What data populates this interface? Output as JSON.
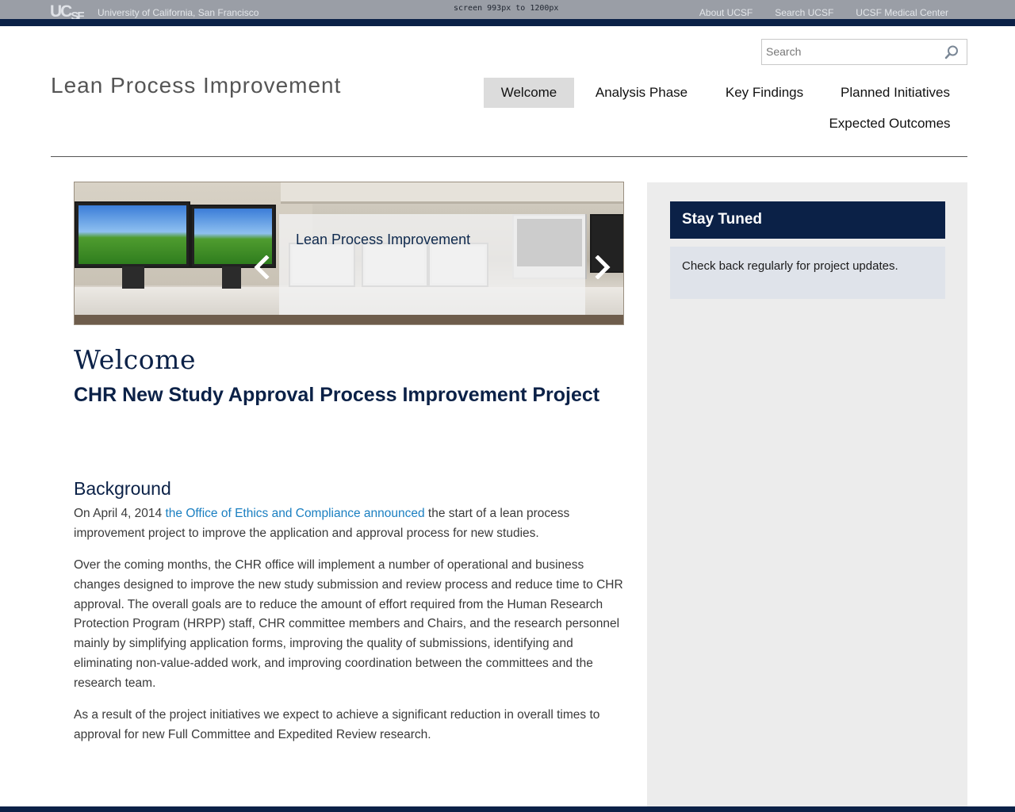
{
  "top_bar": {
    "logo_main": "UC",
    "logo_sub": "SF",
    "university_name": "University of California, San Francisco",
    "screen_note": "screen 993px to 1200px",
    "links": [
      "About UCSF",
      "Search UCSF",
      "UCSF Medical Center"
    ]
  },
  "search": {
    "placeholder": "Search",
    "icon": "search-icon"
  },
  "site_title": "Lean Process Improvement",
  "nav": {
    "items": [
      "Welcome",
      "Analysis Phase",
      "Key Findings",
      "Planned Initiatives",
      "Expected Outcomes"
    ],
    "active": "Welcome"
  },
  "carousel": {
    "caption": "Lean Process Improvement",
    "prev_icon": "chevron-left-icon",
    "next_icon": "chevron-right-icon"
  },
  "main": {
    "welcome_heading": "Welcome",
    "project_title": "CHR New Study Approval Process Improvement Project",
    "background_heading": "Background",
    "para1_start": "On April 4, 2014 ",
    "para1_link": "the Office of Ethics and Compliance announced",
    "para1_end": " the start of a lean process improvement project to improve the application and approval process for new studies.",
    "para2": "Over the coming months, the CHR office will implement a number of operational and business changes designed to improve the new study submission and review process and reduce time to CHR approval. The overall goals are to reduce the amount of effort required from the Human Research Protection Program (HRPP) staff, CHR committee members and Chairs, and the research personnel mainly by simplifying application forms, improving the quality of submissions, identifying and eliminating non-value-added work, and improving coordination between the committees and the research team.",
    "para3": "As a result of the project initiatives we expect to achieve a significant reduction in overall times to approval for new Full Committee and Expedited Review research."
  },
  "sidebar": {
    "heading": "Stay Tuned",
    "body": "Check back regularly for project updates."
  },
  "colors": {
    "navy": "#0b2147",
    "link": "#1a7fc1",
    "top_bar": "#9a9ea6",
    "sidebar_bg": "#ececec"
  }
}
